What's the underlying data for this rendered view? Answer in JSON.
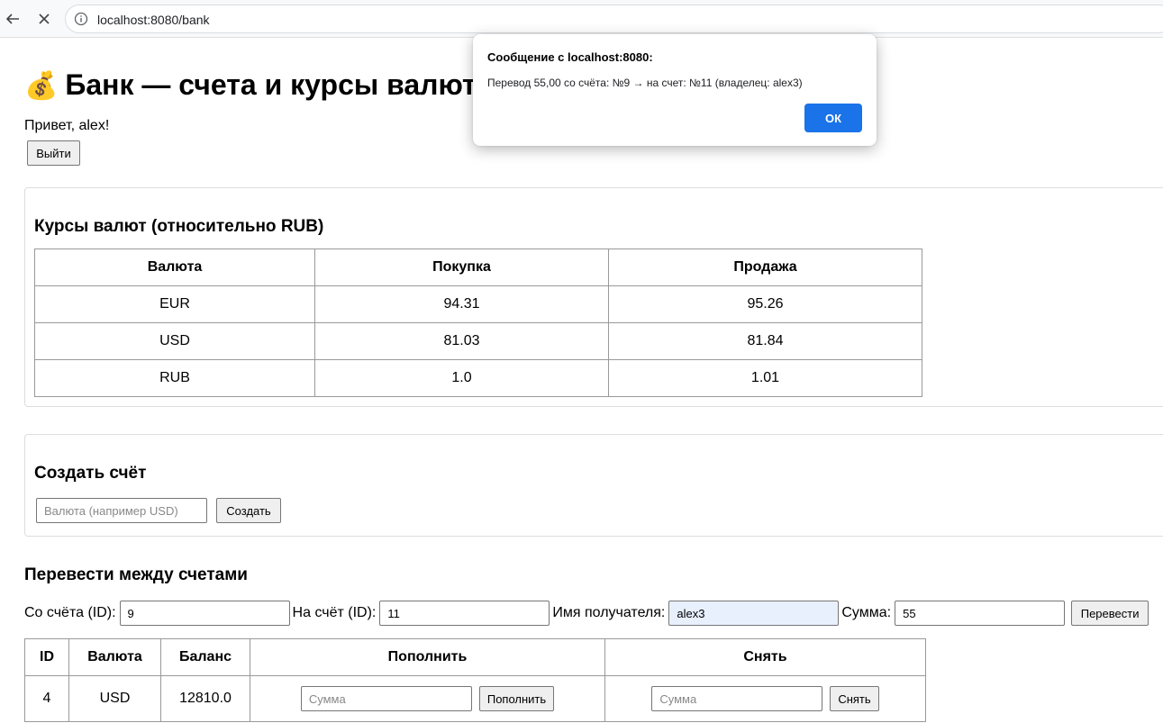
{
  "browser": {
    "url": "localhost:8080/bank"
  },
  "header": {
    "title_emoji": "💰",
    "title": "Банк — счета и курсы валют",
    "greeting": "Привет, alex!",
    "logout_label": "Выйти"
  },
  "rates": {
    "title": "Курсы валют (относительно RUB)",
    "columns": [
      "Валюта",
      "Покупка",
      "Продажа"
    ],
    "rows": [
      [
        "EUR",
        "94.31",
        "95.26"
      ],
      [
        "USD",
        "81.03",
        "81.84"
      ],
      [
        "RUB",
        "1.0",
        "1.01"
      ]
    ]
  },
  "create_account": {
    "title": "Создать счёт",
    "currency_placeholder": "Валюта (например USD)",
    "create_label": "Создать"
  },
  "transfer": {
    "title": "Перевести между счетами",
    "from_label": "Со счёта (ID):",
    "from_value": "9",
    "to_label": "На счёт (ID):",
    "to_value": "11",
    "recipient_label": "Имя получателя:",
    "recipient_value": "alex3",
    "amount_label": "Сумма:",
    "amount_value": "55",
    "transfer_label": "Перевести"
  },
  "accounts": {
    "columns": [
      "ID",
      "Валюта",
      "Баланс",
      "Пополнить",
      "Снять"
    ],
    "rows": [
      {
        "id": "4",
        "currency": "USD",
        "balance": "12810.0",
        "deposit_placeholder": "Сумма",
        "deposit_label": "Пополнить",
        "withdraw_placeholder": "Сумма",
        "withdraw_label": "Снять"
      }
    ]
  },
  "dialog": {
    "title": "Сообщение с localhost:8080:",
    "message": "Перевод 55,00 со счёта: №9 → на счет: №11 (владелец: alex3)",
    "ok_label": "ОК"
  },
  "colors": {
    "accent": "#1a73e8",
    "autofill": "#e8f0fe"
  },
  "icons": [
    "back-arrow-icon",
    "stop-icon",
    "info-icon"
  ]
}
